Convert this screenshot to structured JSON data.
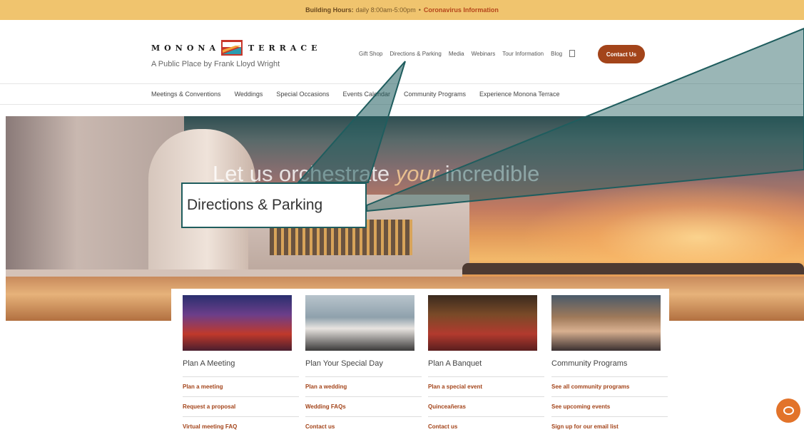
{
  "announcement": {
    "label": "Building Hours:",
    "hours": "daily 8:00am-5:00pm",
    "separator": "•",
    "link": "Coronavirus Information"
  },
  "brand": {
    "word_left": "MONONA",
    "word_right": "TERRACE",
    "tagline": "A Public Place by Frank Lloyd Wright"
  },
  "utility_nav": {
    "items": [
      "Gift Shop",
      "Directions & Parking",
      "Media",
      "Webinars",
      "Tour Information",
      "Blog"
    ],
    "contact_label": "Contact Us"
  },
  "main_nav": {
    "items": [
      "Meetings & Conventions",
      "Weddings",
      "Special Occasions",
      "Events Calendar",
      "Community Programs",
      "Experience Monona Terrace"
    ]
  },
  "hero": {
    "headline_pre": "Let us orchestrate",
    "headline_em": "your",
    "headline_post": "incredible"
  },
  "callout": {
    "text": "Directions & Parking"
  },
  "cards": [
    {
      "title": "Plan A Meeting",
      "links": [
        "Plan a meeting",
        "Request a proposal",
        "Virtual meeting FAQ"
      ]
    },
    {
      "title": "Plan Your Special Day",
      "links": [
        "Plan a wedding",
        "Wedding FAQs",
        "Contact us"
      ]
    },
    {
      "title": "Plan A Banquet",
      "links": [
        "Plan a special event",
        "Quinceañeras",
        "Contact us"
      ]
    },
    {
      "title": "Community Programs",
      "links": [
        "See all community programs",
        "See upcoming events",
        "Sign up for our email list"
      ]
    }
  ],
  "colors": {
    "accent": "#a3441a",
    "topbar": "#f0c46e",
    "callout_border": "#1f5d5e",
    "chat": "#e2732a"
  },
  "icons": {
    "search": "search-icon",
    "chat": "chat-icon",
    "logo": "monona-terrace-logo-icon"
  }
}
